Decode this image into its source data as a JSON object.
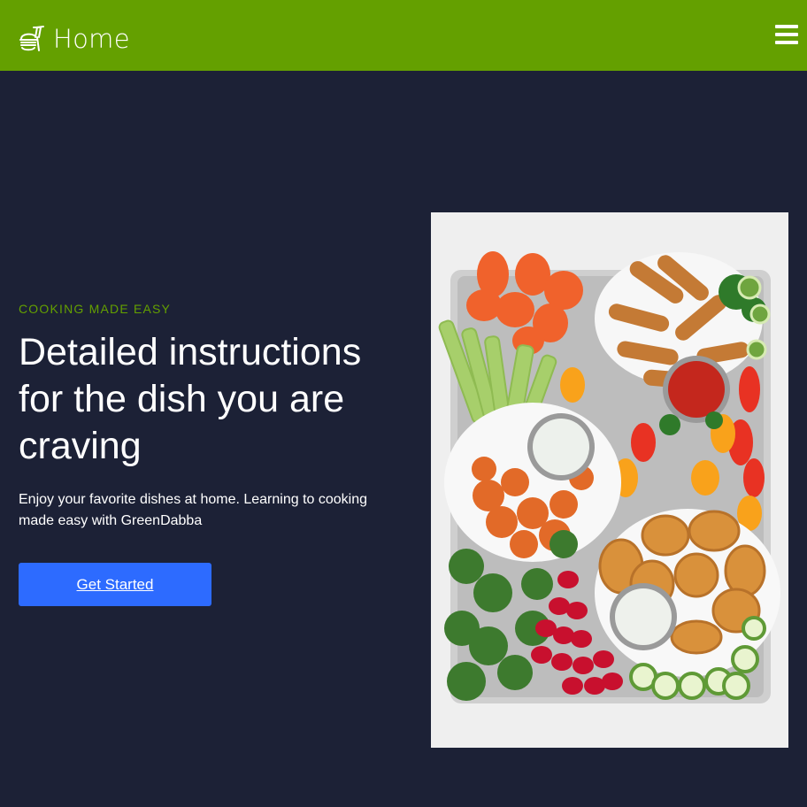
{
  "header": {
    "brand_label": "Home",
    "brand_icon": "food-bowl-icon",
    "menu_icon": "hamburger-menu-icon",
    "background_color": "#64a000"
  },
  "hero": {
    "eyebrow": "COOKING MADE EASY",
    "headline": "Detailed instructions for the dish you are craving",
    "lede": "Enjoy your favorite dishes at home. Learning to cooking made easy with GreenDabba",
    "cta_label": "Get Started",
    "image_alt": "Party platter with vegetables, mozzarella sticks, wings, potato skins and dips"
  },
  "colors": {
    "page_background": "#1c2136",
    "accent": "#64a000",
    "button": "#2d6bff",
    "text": "#ffffff"
  }
}
